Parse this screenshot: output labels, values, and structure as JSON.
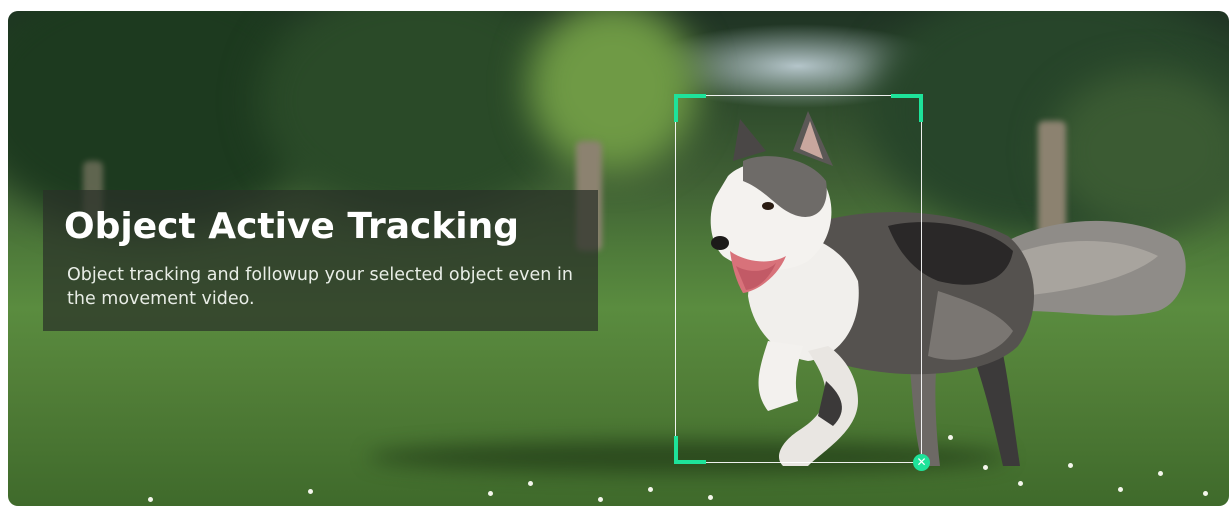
{
  "banner": {
    "title": "Object Active Tracking",
    "description": "Object tracking and followup your selected object even in the movement video."
  },
  "tracking_box": {
    "corner_color": "#1ee39a",
    "close_icon": "close-icon",
    "close_glyph": "✕"
  },
  "colors": {
    "accent": "#1ee39a",
    "panel_background": "rgba(42,48,40,0.72)",
    "title_text": "#ffffff"
  }
}
